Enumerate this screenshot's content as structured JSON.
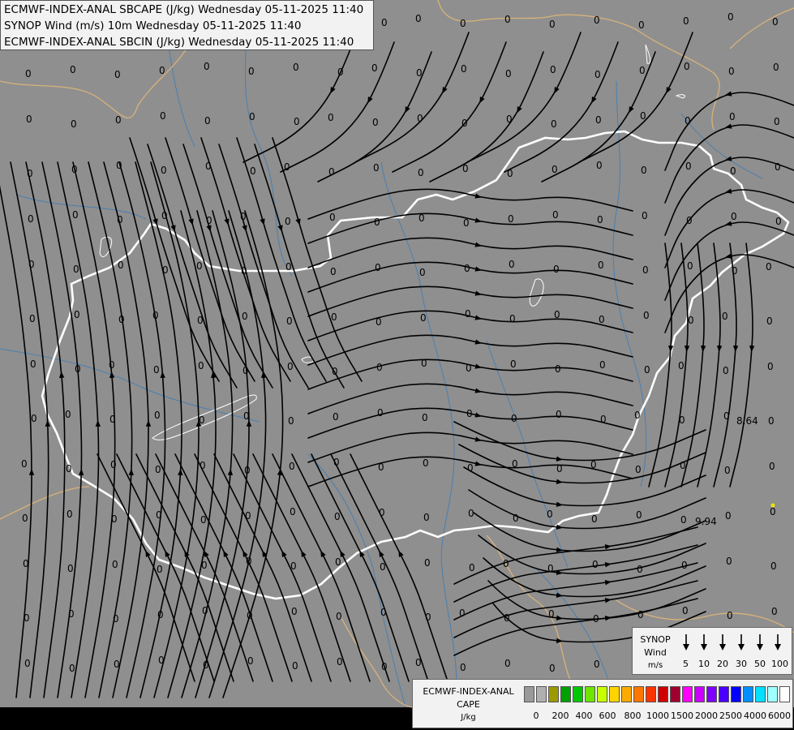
{
  "titles": [
    "ECMWF-INDEX-ANAL SBCAPE (J/kg) Wednesday 05-11-2025 11:40",
    "SYNOP Wind (m/s) 10m Wednesday 05-11-2025 11:40",
    "ECMWF-INDEX-ANAL SBCIN (J/kg) Wednesday 05-11-2025 11:40"
  ],
  "colors": {
    "background": "#8f8f8f",
    "country_border": "#ffffff",
    "neighbour_border": "#d8b27a",
    "river": "#4a7fb0",
    "streamline": "#000000"
  },
  "special_values": [
    "8.64",
    "9.94"
  ],
  "grid_value": "0",
  "wind_legend": {
    "title": "SYNOP",
    "subtitle": "Wind",
    "unit": "m/s",
    "speeds": [
      "5",
      "10",
      "20",
      "30",
      "50",
      "100"
    ]
  },
  "cape_legend": {
    "title": "ECMWF-INDEX-ANAL",
    "subtitle": "CAPE",
    "unit": "J/kg",
    "ticks": [
      "0",
      "200",
      "400",
      "600",
      "800",
      "1000",
      "1500",
      "2000",
      "2500",
      "4000",
      "6000"
    ],
    "swatch_colors": [
      "#9a9a9a",
      "#b0b0b0",
      "#9c9a00",
      "#00a000",
      "#00c800",
      "#6ee600",
      "#c8ff00",
      "#ffd400",
      "#ffaa00",
      "#ff7700",
      "#ff3300",
      "#d00000",
      "#a00030",
      "#ff00ff",
      "#cc00ff",
      "#8000ff",
      "#4a00ff",
      "#0000ff",
      "#0090ff",
      "#00e0ff",
      "#a0ffff",
      "#ffffff"
    ]
  }
}
